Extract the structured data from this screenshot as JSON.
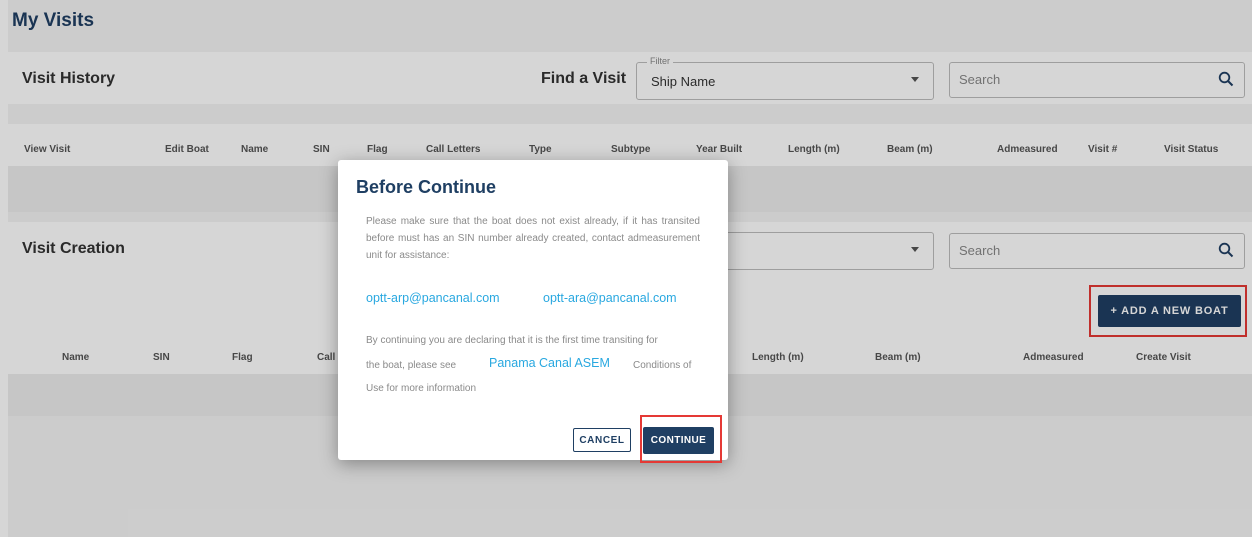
{
  "page": {
    "title": "My Visits"
  },
  "visit_history": {
    "title": "Visit History",
    "find_label": "Find a Visit",
    "filter": {
      "legend": "Filter",
      "value": "Ship Name"
    },
    "search": {
      "placeholder": "Search"
    },
    "columns": [
      "View Visit",
      "Edit Boat",
      "Name",
      "SIN",
      "Flag",
      "Call Letters",
      "Type",
      "Subtype",
      "Year Built",
      "Length (m)",
      "Beam (m)",
      "Admeasured",
      "Visit #",
      "Visit Status"
    ]
  },
  "visit_creation": {
    "title": "Visit Creation",
    "search": {
      "placeholder": "Search"
    },
    "add_button": "+ ADD A NEW BOAT",
    "columns": [
      "Name",
      "SIN",
      "Flag",
      "Call",
      "Length (m)",
      "Beam (m)",
      "Admeasured",
      "Create Visit"
    ]
  },
  "dialog": {
    "title": "Before Continue",
    "message": "Please make sure that the boat does not exist already, if it has transited before must has an SIN number already created, contact admeasurement unit for assistance:",
    "email_1": "optt-arp@pancanal.com",
    "email_2": "optt-ara@pancanal.com",
    "declaration_1": "By continuing you are declaring that it is the first time transiting for",
    "declaration_2a": "the boat, please see",
    "asem_link": "Panama Canal ASEM",
    "declaration_2b": "Conditions of",
    "declaration_3": "Use for more information",
    "cancel_label": "CANCEL",
    "continue_label": "CONTINUE"
  },
  "colors": {
    "primary": "#1f3f63",
    "link": "#29a8e0",
    "highlight": "#e53935"
  }
}
